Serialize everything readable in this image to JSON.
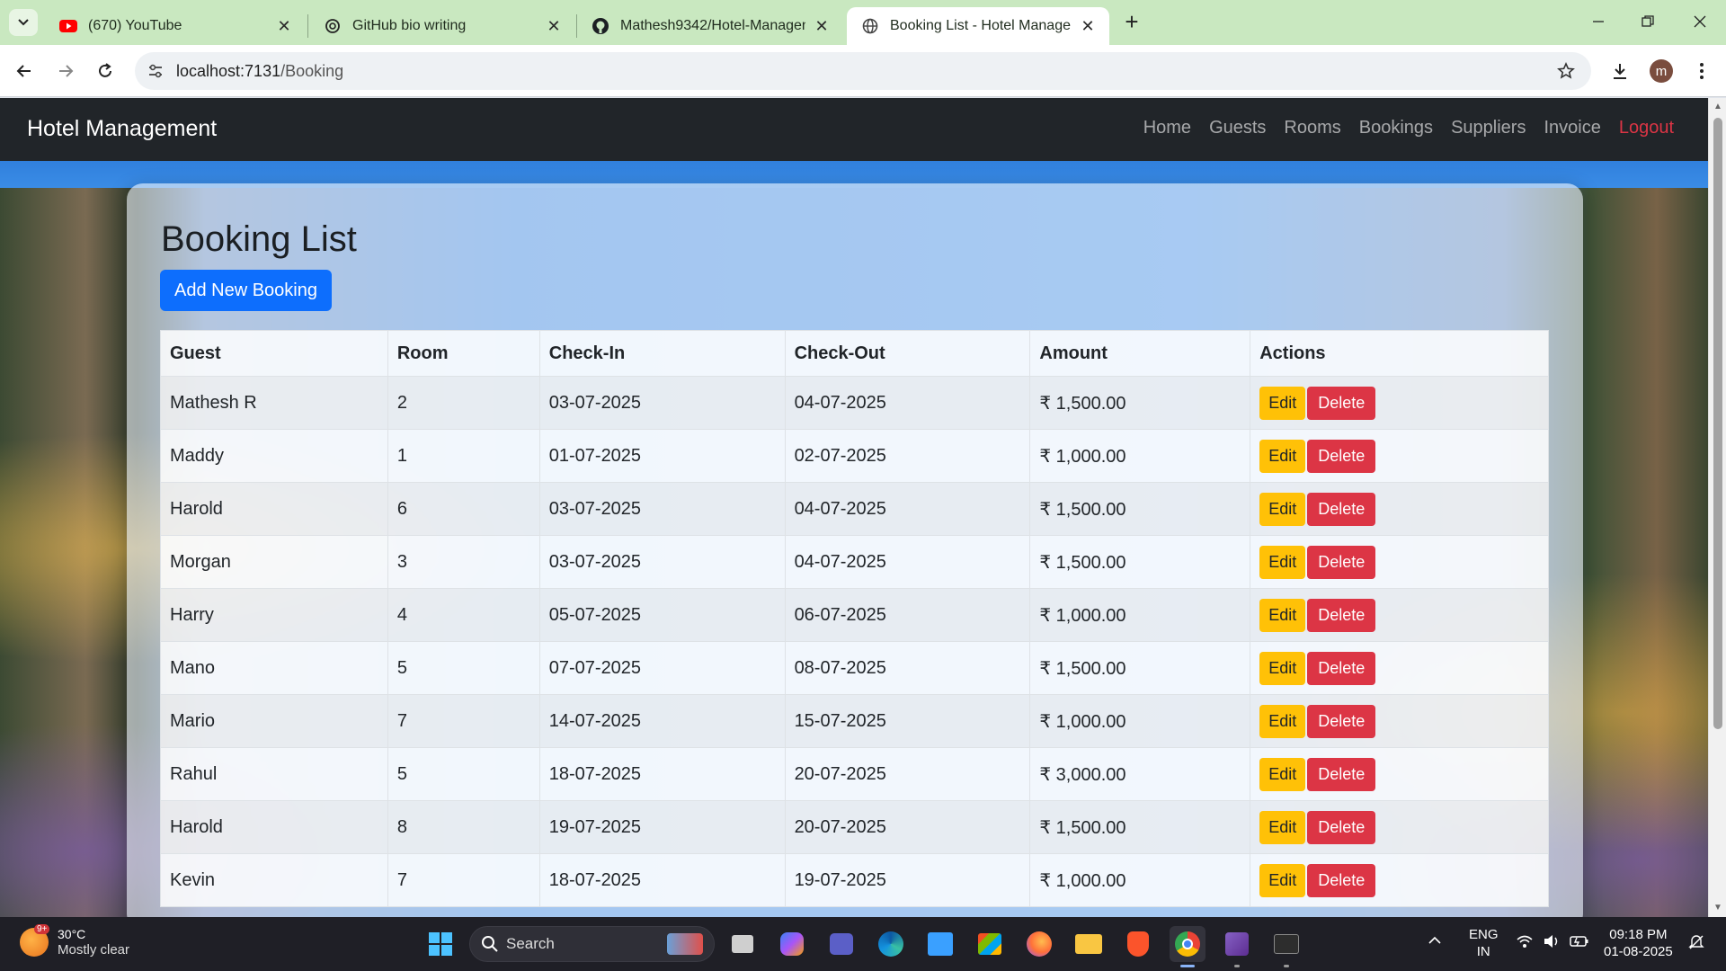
{
  "browser": {
    "tabs": [
      {
        "title": "(670) YouTube",
        "icon": "youtube-icon"
      },
      {
        "title": "GitHub bio writing",
        "icon": "chatgpt-icon"
      },
      {
        "title": "Mathesh9342/Hotel-Management",
        "icon": "github-icon"
      },
      {
        "title": "Booking List - Hotel Management",
        "icon": "globe-icon",
        "active": true
      }
    ],
    "url_host": "localhost:7131",
    "url_path": "/Booking"
  },
  "app": {
    "brand": "Hotel Management",
    "nav": [
      "Home",
      "Guests",
      "Rooms",
      "Bookings",
      "Suppliers",
      "Invoice"
    ],
    "logout": "Logout",
    "page_title": "Booking List",
    "add_button": "Add New Booking",
    "columns": [
      "Guest",
      "Room",
      "Check-In",
      "Check-Out",
      "Amount",
      "Actions"
    ],
    "edit_label": "Edit",
    "delete_label": "Delete",
    "bookings": [
      {
        "guest": "Mathesh R",
        "room": "2",
        "check_in": "03-07-2025",
        "check_out": "04-07-2025",
        "amount": "₹ 1,500.00"
      },
      {
        "guest": "Maddy",
        "room": "1",
        "check_in": "01-07-2025",
        "check_out": "02-07-2025",
        "amount": "₹ 1,000.00"
      },
      {
        "guest": "Harold",
        "room": "6",
        "check_in": "03-07-2025",
        "check_out": "04-07-2025",
        "amount": "₹ 1,500.00"
      },
      {
        "guest": "Morgan",
        "room": "3",
        "check_in": "03-07-2025",
        "check_out": "04-07-2025",
        "amount": "₹ 1,500.00"
      },
      {
        "guest": "Harry",
        "room": "4",
        "check_in": "05-07-2025",
        "check_out": "06-07-2025",
        "amount": "₹ 1,000.00"
      },
      {
        "guest": "Mano",
        "room": "5",
        "check_in": "07-07-2025",
        "check_out": "08-07-2025",
        "amount": "₹ 1,500.00"
      },
      {
        "guest": "Mario",
        "room": "7",
        "check_in": "14-07-2025",
        "check_out": "15-07-2025",
        "amount": "₹ 1,000.00"
      },
      {
        "guest": "Rahul",
        "room": "5",
        "check_in": "18-07-2025",
        "check_out": "20-07-2025",
        "amount": "₹ 3,000.00"
      },
      {
        "guest": "Harold",
        "room": "8",
        "check_in": "19-07-2025",
        "check_out": "20-07-2025",
        "amount": "₹ 1,500.00"
      },
      {
        "guest": "Kevin",
        "room": "7",
        "check_in": "18-07-2025",
        "check_out": "19-07-2025",
        "amount": "₹ 1,000.00"
      }
    ]
  },
  "taskbar": {
    "weather_temp": "30°C",
    "weather_desc": "Mostly clear",
    "weather_badge": "9+",
    "search_label": "Search",
    "lang_1": "ENG",
    "lang_2": "IN",
    "time": "09:18 PM",
    "date": "01-08-2025"
  },
  "colors": {
    "primary": "#0d6efd",
    "warning": "#ffc107",
    "danger": "#dc3545",
    "navbar": "#212529",
    "tab_strip": "#c9e8c0"
  }
}
